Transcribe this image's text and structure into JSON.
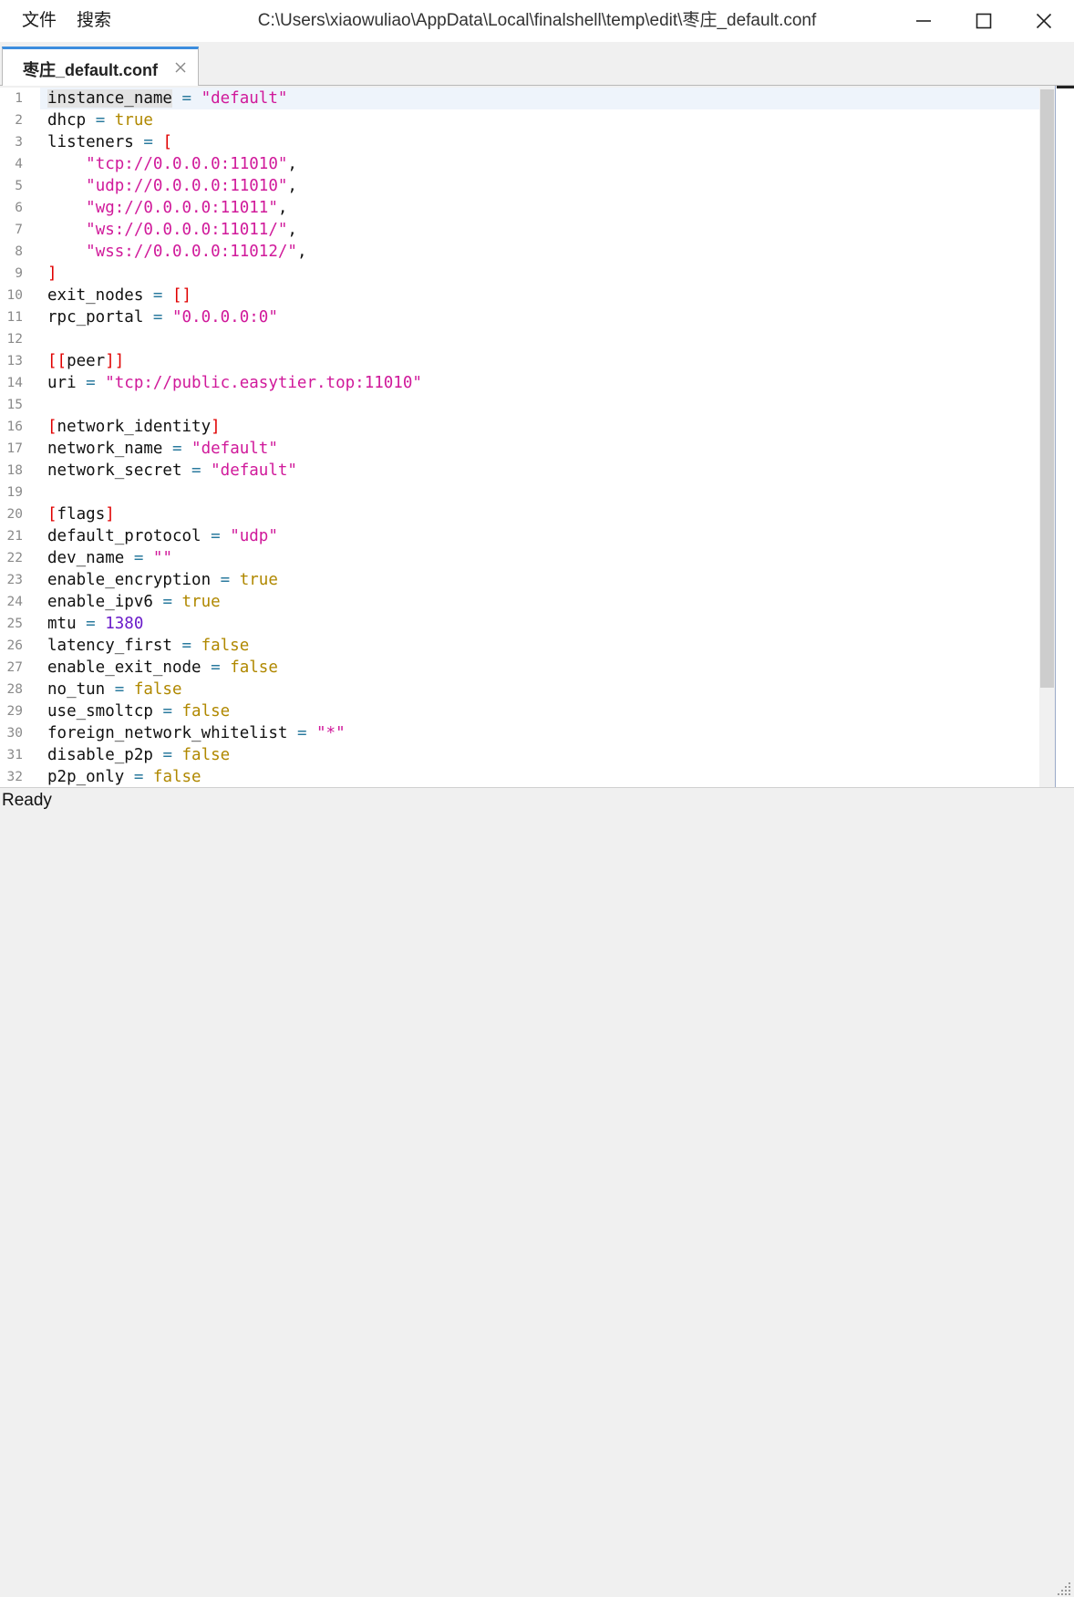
{
  "window": {
    "title": "C:\\Users\\xiaowuliao\\AppData\\Local\\finalshell\\temp\\edit\\枣庄_default.conf",
    "menu": [
      "文件",
      "搜索"
    ]
  },
  "tab": {
    "label": "枣庄_default.conf"
  },
  "status": {
    "text": "Ready"
  },
  "editor": {
    "line_numbers": [
      "1",
      "2",
      "3",
      "4",
      "5",
      "6",
      "7",
      "8",
      "9",
      "10",
      "11",
      "12",
      "13",
      "14",
      "15",
      "16",
      "17",
      "18",
      "19",
      "20",
      "21",
      "22",
      "23",
      "24",
      "25",
      "26",
      "27",
      "28",
      "29",
      "30",
      "31",
      "32"
    ],
    "lines": [
      [
        [
          "key",
          "instance_name"
        ],
        [
          "op",
          " = "
        ],
        [
          "str",
          "\"default\""
        ]
      ],
      [
        [
          "key",
          "dhcp"
        ],
        [
          "op",
          " = "
        ],
        [
          "bool",
          "true"
        ]
      ],
      [
        [
          "key",
          "listeners"
        ],
        [
          "op",
          " = "
        ],
        [
          "br",
          "["
        ]
      ],
      [
        [
          "pun",
          "    "
        ],
        [
          "str",
          "\"tcp://0.0.0.0:11010\""
        ],
        [
          "pun",
          ","
        ]
      ],
      [
        [
          "pun",
          "    "
        ],
        [
          "str",
          "\"udp://0.0.0.0:11010\""
        ],
        [
          "pun",
          ","
        ]
      ],
      [
        [
          "pun",
          "    "
        ],
        [
          "str",
          "\"wg://0.0.0.0:11011\""
        ],
        [
          "pun",
          ","
        ]
      ],
      [
        [
          "pun",
          "    "
        ],
        [
          "str",
          "\"ws://0.0.0.0:11011/\""
        ],
        [
          "pun",
          ","
        ]
      ],
      [
        [
          "pun",
          "    "
        ],
        [
          "str",
          "\"wss://0.0.0.0:11012/\""
        ],
        [
          "pun",
          ","
        ]
      ],
      [
        [
          "br",
          "]"
        ]
      ],
      [
        [
          "key",
          "exit_nodes"
        ],
        [
          "op",
          " = "
        ],
        [
          "br",
          "[]"
        ]
      ],
      [
        [
          "key",
          "rpc_portal"
        ],
        [
          "op",
          " = "
        ],
        [
          "str",
          "\"0.0.0.0:0\""
        ]
      ],
      [],
      [
        [
          "br",
          "[["
        ],
        [
          "key",
          "peer"
        ],
        [
          "br",
          "]]"
        ]
      ],
      [
        [
          "key",
          "uri"
        ],
        [
          "op",
          " = "
        ],
        [
          "str",
          "\"tcp://public.easytier.top:11010\""
        ]
      ],
      [],
      [
        [
          "br",
          "["
        ],
        [
          "key",
          "network_identity"
        ],
        [
          "br",
          "]"
        ]
      ],
      [
        [
          "key",
          "network_name"
        ],
        [
          "op",
          " = "
        ],
        [
          "str",
          "\"default\""
        ]
      ],
      [
        [
          "key",
          "network_secret"
        ],
        [
          "op",
          " = "
        ],
        [
          "str",
          "\"default\""
        ]
      ],
      [],
      [
        [
          "br",
          "["
        ],
        [
          "key",
          "flags"
        ],
        [
          "br",
          "]"
        ]
      ],
      [
        [
          "key",
          "default_protocol"
        ],
        [
          "op",
          " = "
        ],
        [
          "str",
          "\"udp\""
        ]
      ],
      [
        [
          "key",
          "dev_name"
        ],
        [
          "op",
          " = "
        ],
        [
          "str",
          "\"\""
        ]
      ],
      [
        [
          "key",
          "enable_encryption"
        ],
        [
          "op",
          " = "
        ],
        [
          "bool",
          "true"
        ]
      ],
      [
        [
          "key",
          "enable_ipv6"
        ],
        [
          "op",
          " = "
        ],
        [
          "bool",
          "true"
        ]
      ],
      [
        [
          "key",
          "mtu"
        ],
        [
          "op",
          " = "
        ],
        [
          "num",
          "1380"
        ]
      ],
      [
        [
          "key",
          "latency_first"
        ],
        [
          "op",
          " = "
        ],
        [
          "bool",
          "false"
        ]
      ],
      [
        [
          "key",
          "enable_exit_node"
        ],
        [
          "op",
          " = "
        ],
        [
          "bool",
          "false"
        ]
      ],
      [
        [
          "key",
          "no_tun"
        ],
        [
          "op",
          " = "
        ],
        [
          "bool",
          "false"
        ]
      ],
      [
        [
          "key",
          "use_smoltcp"
        ],
        [
          "op",
          " = "
        ],
        [
          "bool",
          "false"
        ]
      ],
      [
        [
          "key",
          "foreign_network_whitelist"
        ],
        [
          "op",
          " = "
        ],
        [
          "str",
          "\"*\""
        ]
      ],
      [
        [
          "key",
          "disable_p2p"
        ],
        [
          "op",
          " = "
        ],
        [
          "bool",
          "false"
        ]
      ],
      [
        [
          "key",
          "p2p_only"
        ],
        [
          "op",
          " = "
        ],
        [
          "bool",
          "false"
        ]
      ]
    ]
  },
  "colors": {
    "key": "#111111",
    "operator": "#2a7a9e",
    "string": "#d0199a",
    "boolean": "#b08800",
    "number": "#6a1bc9",
    "bracket": "#e00000",
    "tab_accent": "#3c8dde"
  },
  "icons": {
    "minimize": "minimize-icon",
    "maximize": "maximize-icon",
    "close": "close-icon",
    "tab_close": "tab-close-icon",
    "resize_grip": "resize-grip-icon"
  }
}
